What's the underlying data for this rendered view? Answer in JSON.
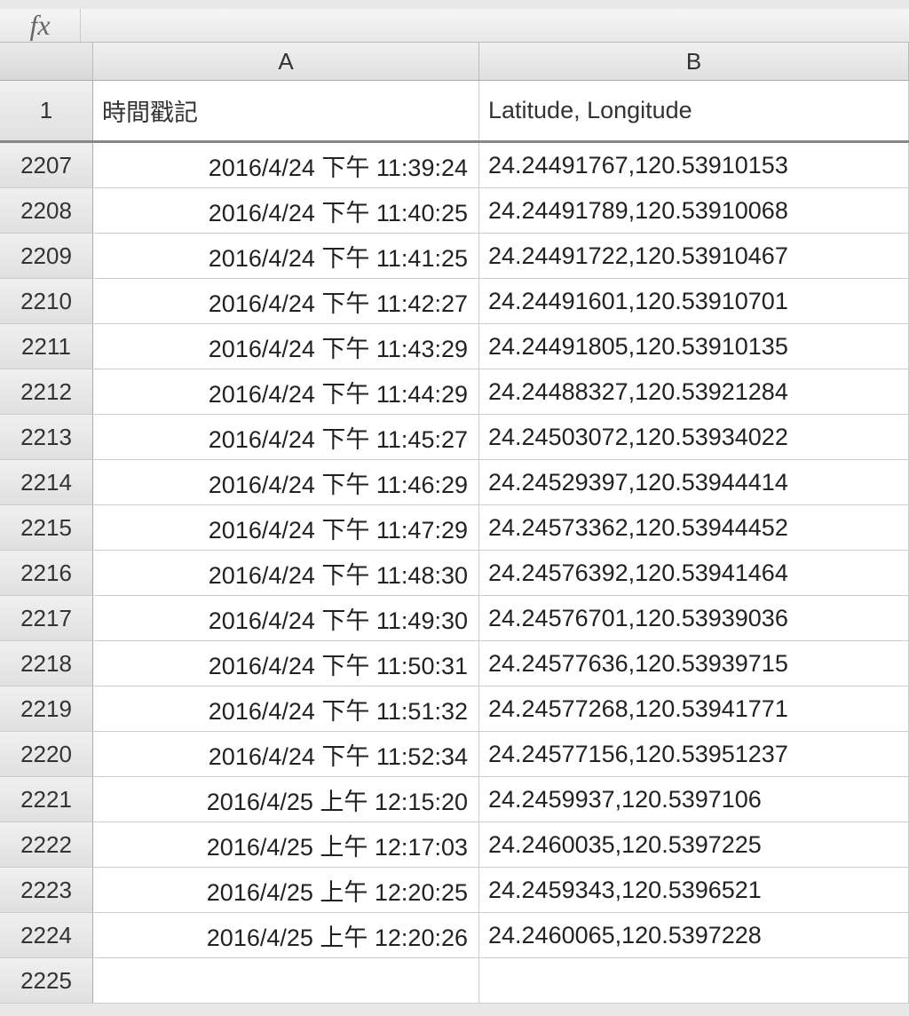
{
  "formula_bar": {
    "fx_symbol": "fx",
    "formula_value": ""
  },
  "columns": {
    "a_label": "A",
    "b_label": "B"
  },
  "header_row": {
    "row_num": "1",
    "col_a": "時間戳記",
    "col_b": "Latitude, Longitude"
  },
  "rows": [
    {
      "num": "2207",
      "a": "2016/4/24 下午 11:39:24",
      "b": "24.24491767,120.53910153"
    },
    {
      "num": "2208",
      "a": "2016/4/24 下午 11:40:25",
      "b": "24.24491789,120.53910068"
    },
    {
      "num": "2209",
      "a": "2016/4/24 下午 11:41:25",
      "b": "24.24491722,120.53910467"
    },
    {
      "num": "2210",
      "a": "2016/4/24 下午 11:42:27",
      "b": "24.24491601,120.53910701"
    },
    {
      "num": "2211",
      "a": "2016/4/24 下午 11:43:29",
      "b": "24.24491805,120.53910135"
    },
    {
      "num": "2212",
      "a": "2016/4/24 下午 11:44:29",
      "b": "24.24488327,120.53921284"
    },
    {
      "num": "2213",
      "a": "2016/4/24 下午 11:45:27",
      "b": "24.24503072,120.53934022"
    },
    {
      "num": "2214",
      "a": "2016/4/24 下午 11:46:29",
      "b": "24.24529397,120.53944414"
    },
    {
      "num": "2215",
      "a": "2016/4/24 下午 11:47:29",
      "b": "24.24573362,120.53944452"
    },
    {
      "num": "2216",
      "a": "2016/4/24 下午 11:48:30",
      "b": "24.24576392,120.53941464"
    },
    {
      "num": "2217",
      "a": "2016/4/24 下午 11:49:30",
      "b": "24.24576701,120.53939036"
    },
    {
      "num": "2218",
      "a": "2016/4/24 下午 11:50:31",
      "b": "24.24577636,120.53939715"
    },
    {
      "num": "2219",
      "a": "2016/4/24 下午 11:51:32",
      "b": "24.24577268,120.53941771"
    },
    {
      "num": "2220",
      "a": "2016/4/24 下午 11:52:34",
      "b": "24.24577156,120.53951237"
    },
    {
      "num": "2221",
      "a": "2016/4/25 上午 12:15:20",
      "b": "24.2459937,120.5397106"
    },
    {
      "num": "2222",
      "a": "2016/4/25 上午 12:17:03",
      "b": "24.2460035,120.5397225"
    },
    {
      "num": "2223",
      "a": "2016/4/25 上午 12:20:25",
      "b": "24.2459343,120.5396521"
    },
    {
      "num": "2224",
      "a": "2016/4/25 上午 12:20:26",
      "b": "24.2460065,120.5397228"
    },
    {
      "num": "2225",
      "a": "",
      "b": ""
    }
  ]
}
